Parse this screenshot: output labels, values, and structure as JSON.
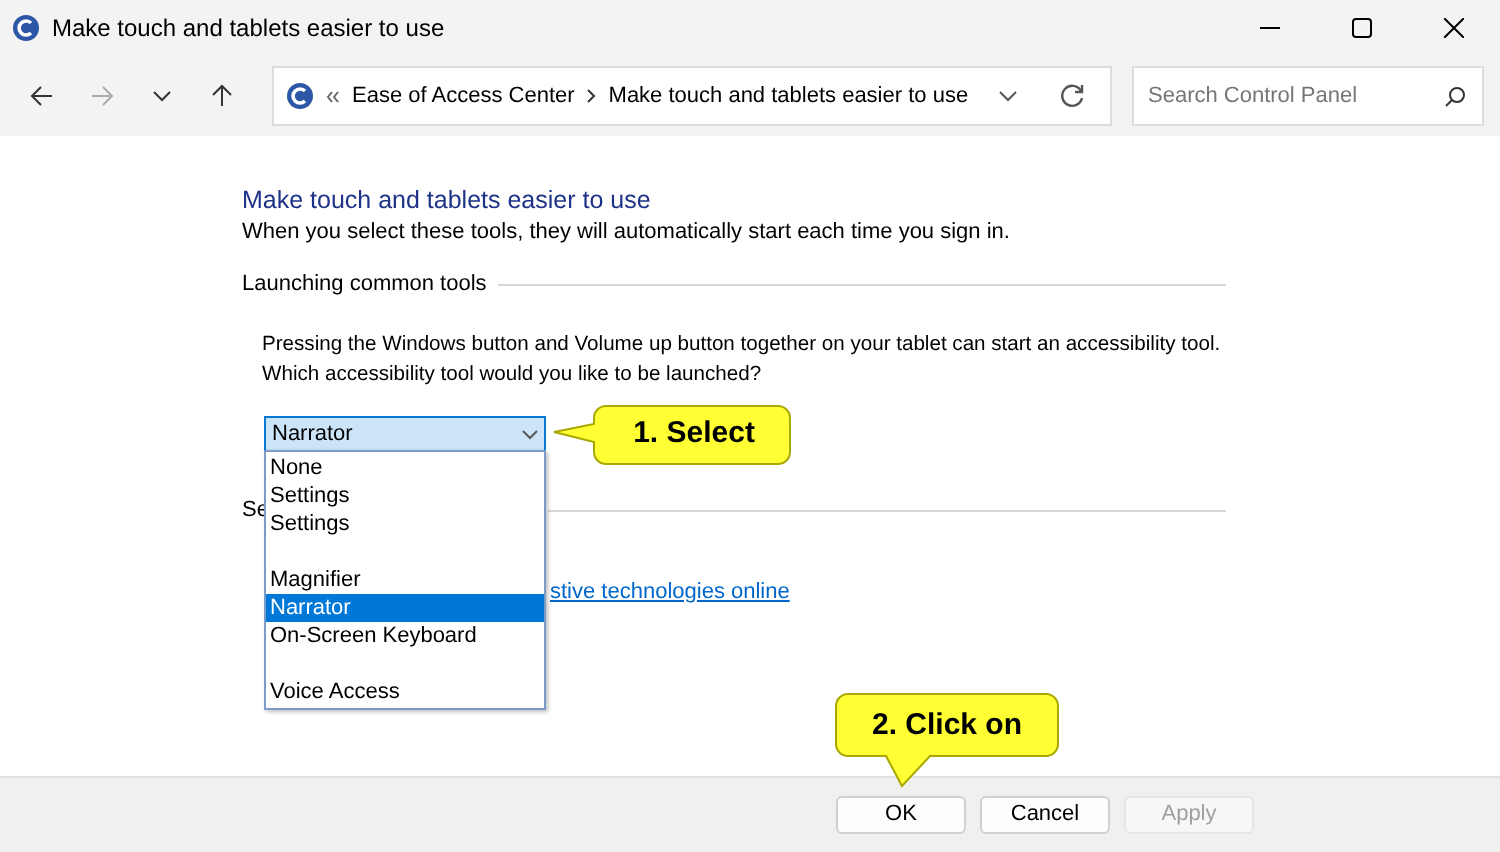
{
  "window": {
    "title": "Make touch and tablets easier to use"
  },
  "address_bar": {
    "crumbs": [
      "Ease of Access Center",
      "Make touch and tablets easier to use"
    ]
  },
  "search": {
    "placeholder": "Search Control Panel"
  },
  "heading": "Make touch and tablets easier to use",
  "subtitle": "When you select these tools, they will automatically start each time you sign in.",
  "section": {
    "title": "Launching common tools",
    "description": "Pressing the Windows button and Volume up button together on your tablet can start an accessibility tool. Which accessibility tool would you like to be launched?"
  },
  "dropdown": {
    "value": "Narrator",
    "expanded": true,
    "options": [
      {
        "kind": "option",
        "label": "None",
        "selected": false
      },
      {
        "kind": "option",
        "label": "Settings",
        "selected": false
      },
      {
        "kind": "option",
        "label": "Settings",
        "selected": false
      },
      {
        "kind": "blank"
      },
      {
        "kind": "option",
        "label": "Magnifier",
        "selected": false
      },
      {
        "kind": "option",
        "label": "Narrator",
        "selected": true
      },
      {
        "kind": "option",
        "label": "On-Screen Keyboard",
        "selected": false
      },
      {
        "kind": "blank"
      },
      {
        "kind": "option",
        "label": "Voice Access",
        "selected": false
      }
    ]
  },
  "see_also": {
    "title": "Se",
    "link": "stive technologies online"
  },
  "callouts": [
    "1. Select",
    "2. Click on"
  ],
  "buttons": [
    {
      "label": "OK",
      "disabled": false
    },
    {
      "label": "Cancel",
      "disabled": false
    },
    {
      "label": "Apply",
      "disabled": true
    }
  ]
}
